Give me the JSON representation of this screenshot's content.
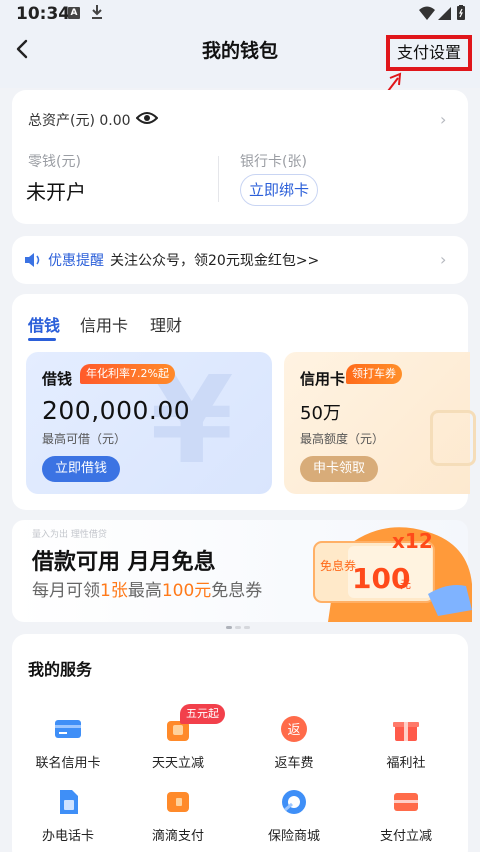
{
  "status_bar": {
    "time": "10:34",
    "notif_letter": "A"
  },
  "header": {
    "title": "我的钱包",
    "pay_settings": "支付设置"
  },
  "assets": {
    "label": "总资产(元) 0.00",
    "change_label": "零钱(元)",
    "change_value": "未开户",
    "bank_label": "银行卡(张)",
    "bind_button": "立即绑卡"
  },
  "notice": {
    "tag": "优惠提醒",
    "text": "关注公众号，领20元现金红包>>"
  },
  "finance": {
    "tabs": [
      "借钱",
      "信用卡",
      "理财"
    ],
    "loan": {
      "title": "借钱",
      "badge": "年化利率7.2%起",
      "amount": "200,000.00",
      "sub": "最高可借（元）",
      "button": "立即借钱",
      "deco": "¥"
    },
    "credit": {
      "title": "信用卡",
      "badge": "领打车券",
      "amount": "50万",
      "sub": "最高额度（元）",
      "button": "申卡领取"
    }
  },
  "banner": {
    "small": "量入为出 理性借贷",
    "title": "借款可用 月月免息",
    "sub_a": "每月可领",
    "sub_b": "1张",
    "sub_c": "最高",
    "sub_d": "100元",
    "sub_e": "免息券",
    "coupon_left": "免息券",
    "coupon_value": "100",
    "coupon_unit": "元",
    "coupon_multiplier": "x12"
  },
  "services": {
    "title": "我的服务",
    "items": [
      {
        "label": "联名信用卡",
        "icon": "credit-card-icon"
      },
      {
        "label": "天天立减",
        "icon": "gift-bag-icon",
        "badge": "五元起"
      },
      {
        "label": "返车费",
        "icon": "refund-icon",
        "glyph": "返"
      },
      {
        "label": "福利社",
        "icon": "gift-box-icon"
      },
      {
        "label": "办电话卡",
        "icon": "sim-card-icon"
      },
      {
        "label": "滴滴支付",
        "icon": "wallet-icon"
      },
      {
        "label": "保险商城",
        "icon": "shield-icon"
      },
      {
        "label": "支付立减",
        "icon": "payment-card-icon"
      }
    ]
  },
  "colors": {
    "accent": "#2b5fd9",
    "highlight_box": "#e0161b",
    "orange": "#ff7a1a"
  }
}
